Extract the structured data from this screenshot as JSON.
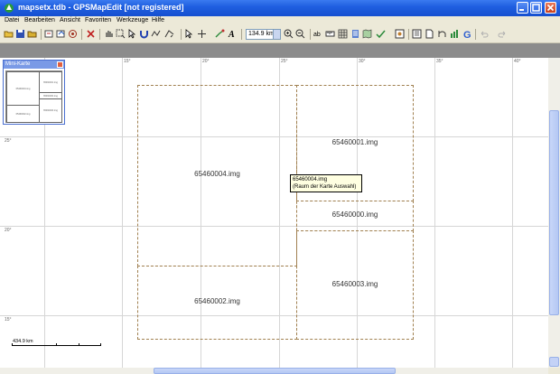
{
  "window": {
    "title": "mapsetx.tdb - GPSMapEdit [not registered]"
  },
  "menu": {
    "items": [
      "Datei",
      "Bearbeiten",
      "Ansicht",
      "Favoriten",
      "Werkzeuge",
      "Hilfe"
    ]
  },
  "toolbar": {
    "scale_value": "134.9 km"
  },
  "map": {
    "coords_top": [
      "15°",
      "20°",
      "25°",
      "30°",
      "35°",
      "40°"
    ],
    "coords_left": [
      "25°",
      "20°",
      "15°"
    ],
    "tiles": [
      {
        "name": "65460004.img"
      },
      {
        "name": "65460001.img"
      },
      {
        "name": "65460000.img"
      },
      {
        "name": "65460002.img"
      },
      {
        "name": "65460003.img"
      }
    ],
    "tooltip_line1": "65460004.img",
    "tooltip_line2": "(Raum der Karte Auswahl)",
    "scale_label": "434.9 km"
  },
  "minimap": {
    "title": "Mini-Karte",
    "tiles": [
      "65460004.img",
      "65460001.img",
      "65460000.img",
      "65460002.img",
      "65460003.img"
    ]
  },
  "colors": {
    "titlebar": "#1f5fe0",
    "tile_border": "#a08050",
    "tooltip_bg": "#ffffe1"
  }
}
